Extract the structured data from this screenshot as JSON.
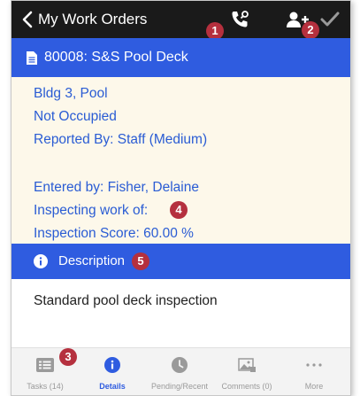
{
  "appbar": {
    "title": "My Work Orders",
    "icons": [
      "back-icon",
      "call-icon",
      "add-user-icon",
      "check-icon"
    ]
  },
  "badges": [
    "1",
    "2",
    "3",
    "4",
    "5"
  ],
  "work_order": {
    "title": "80008: S&S Pool Deck",
    "location": "Bldg 3, Pool",
    "occupancy": "Not Occupied",
    "reported_by": "Reported By: Staff  (Medium)",
    "entered_by": "Entered by: Fisher, Delaine",
    "inspecting": "Inspecting work of:",
    "inspection_score": "Inspection Score: 60.00 %"
  },
  "description": {
    "header": "Description",
    "text": "Standard pool deck inspection"
  },
  "tabs": [
    {
      "label": "Tasks (14)",
      "icon": "list-icon"
    },
    {
      "label": "Details",
      "icon": "info-icon"
    },
    {
      "label": "Pending/Recent",
      "icon": "clock-icon"
    },
    {
      "label": "Comments (0)",
      "icon": "image-icon"
    },
    {
      "label": "More",
      "icon": "more-icon"
    }
  ],
  "colors": {
    "appbar": "#1a1a1a",
    "accent": "#2f5ce0",
    "panel": "#fdf8ea",
    "link": "#2a5cd4",
    "badge": "#b5303e"
  }
}
